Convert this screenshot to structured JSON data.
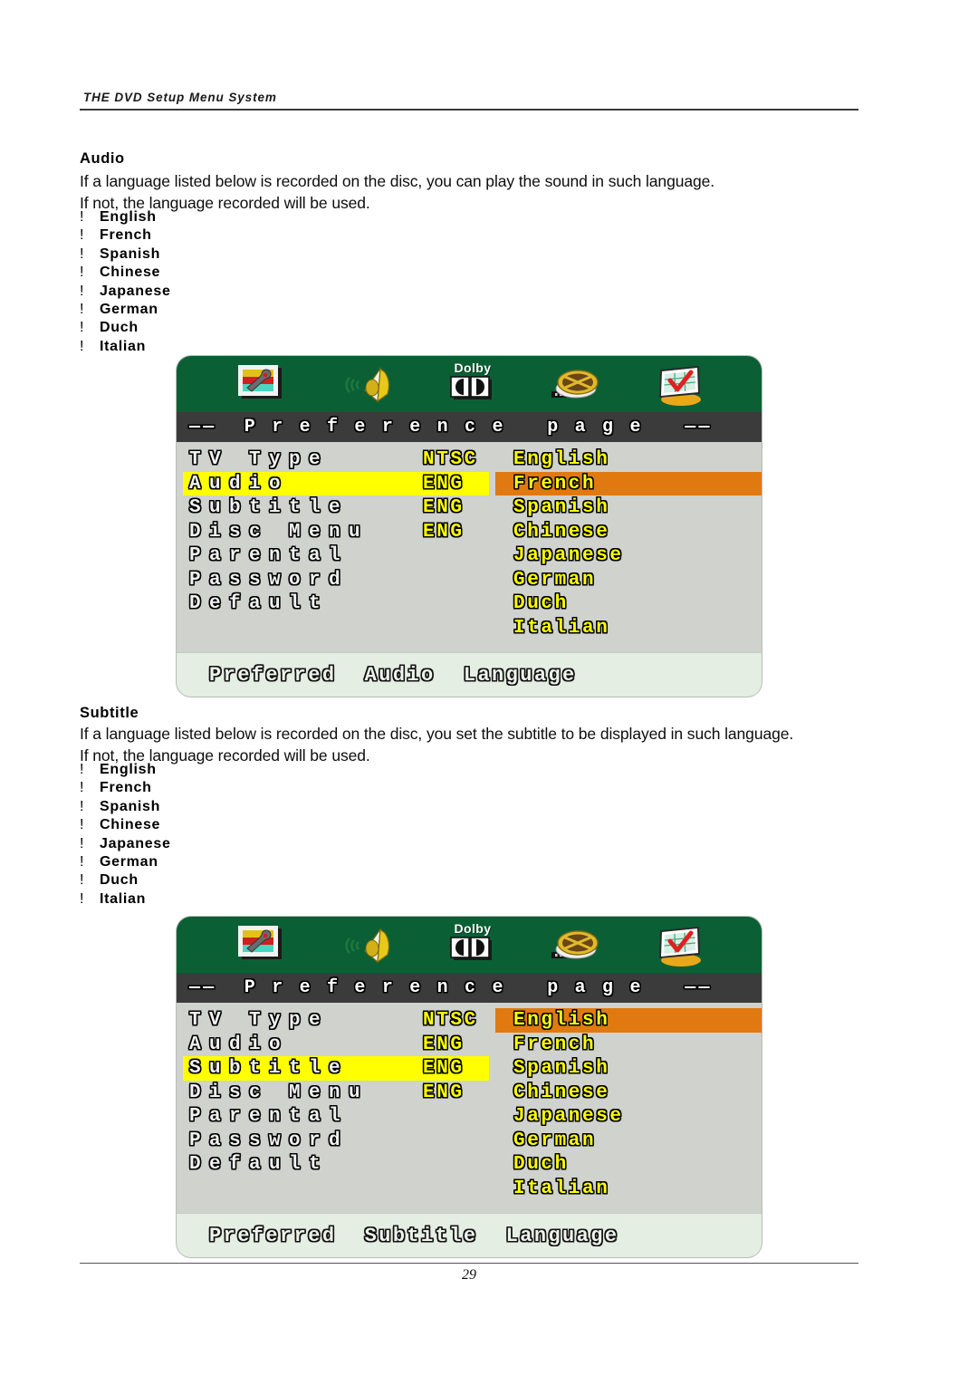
{
  "header": {
    "running_head": "THE DVD Setup Menu System"
  },
  "footer": {
    "page_number": "29"
  },
  "sections": [
    {
      "id": "audio",
      "title": "Audio",
      "paragraph": "If a language listed below is recorded on the disc, you can play the sound in such language.\nIf not, the language recorded will be used.",
      "bullet_char": "!",
      "languages": [
        "English",
        "French",
        "Spanish",
        "Chinese",
        "Japanese",
        "German",
        "Duch",
        "Italian"
      ]
    },
    {
      "id": "subtitle",
      "title": "Subtitle",
      "paragraph": "If a language listed below is recorded on the disc, you set the subtitle to be displayed in such language.\nIf not, the language recorded will be used.",
      "bullet_char": "!",
      "languages": [
        "English",
        "French",
        "Spanish",
        "Chinese",
        "Japanese",
        "German",
        "Duch",
        "Italian"
      ]
    }
  ],
  "osd_screens": [
    {
      "id": "audio-osd",
      "icons": [
        "tv-setup-icon",
        "speaker-icon",
        "dolby-logo-icon",
        "disc-icon",
        "preference-icon"
      ],
      "dolby_label": "Dolby",
      "title": "——  P r e f e r e n c e   p a g e   ——",
      "menu_items": [
        {
          "label": "TV Type",
          "value": "NTSC",
          "highlighted": false
        },
        {
          "label": "Audio",
          "value": "ENG",
          "highlighted": true
        },
        {
          "label": "Subtitle",
          "value": "ENG",
          "highlighted": false
        },
        {
          "label": "Disc Menu",
          "value": "ENG",
          "highlighted": false
        },
        {
          "label": "Parental",
          "value": "",
          "highlighted": false
        },
        {
          "label": "Password",
          "value": "",
          "highlighted": false
        },
        {
          "label": "Default",
          "value": "",
          "highlighted": false
        }
      ],
      "options": [
        {
          "label": "English",
          "selected": false
        },
        {
          "label": "French",
          "selected": true
        },
        {
          "label": "Spanish",
          "selected": false
        },
        {
          "label": "Chinese",
          "selected": false
        },
        {
          "label": "Japanese",
          "selected": false
        },
        {
          "label": "German",
          "selected": false
        },
        {
          "label": "Duch",
          "selected": false
        },
        {
          "label": "Italian",
          "selected": false
        }
      ],
      "caption": "Preferred  Audio  Language"
    },
    {
      "id": "subtitle-osd",
      "icons": [
        "tv-setup-icon",
        "speaker-icon",
        "dolby-logo-icon",
        "disc-icon",
        "preference-icon"
      ],
      "dolby_label": "Dolby",
      "title": "——  P r e f e r e n c e   p a g e   ——",
      "menu_items": [
        {
          "label": "TV Type",
          "value": "NTSC",
          "highlighted": false
        },
        {
          "label": "Audio",
          "value": "ENG",
          "highlighted": false
        },
        {
          "label": "Subtitle",
          "value": "ENG",
          "highlighted": true
        },
        {
          "label": "Disc Menu",
          "value": "ENG",
          "highlighted": false
        },
        {
          "label": "Parental",
          "value": "",
          "highlighted": false
        },
        {
          "label": "Password",
          "value": "",
          "highlighted": false
        },
        {
          "label": "Default",
          "value": "",
          "highlighted": false
        }
      ],
      "options": [
        {
          "label": "English",
          "selected": true
        },
        {
          "label": "French",
          "selected": false
        },
        {
          "label": "Spanish",
          "selected": false
        },
        {
          "label": "Chinese",
          "selected": false
        },
        {
          "label": "Japanese",
          "selected": false
        },
        {
          "label": "German",
          "selected": false
        },
        {
          "label": "Duch",
          "selected": false
        },
        {
          "label": "Italian",
          "selected": false
        }
      ],
      "caption": "Preferred  Subtitle  Language"
    }
  ],
  "colors": {
    "osd_green": "#0a6034",
    "osd_titlebar": "#3b3b3b",
    "osd_body": "#cfd2cd",
    "highlight_yellow": "#ffff00",
    "highlight_orange": "#e07a10",
    "caption_bg": "#e4eee2"
  }
}
